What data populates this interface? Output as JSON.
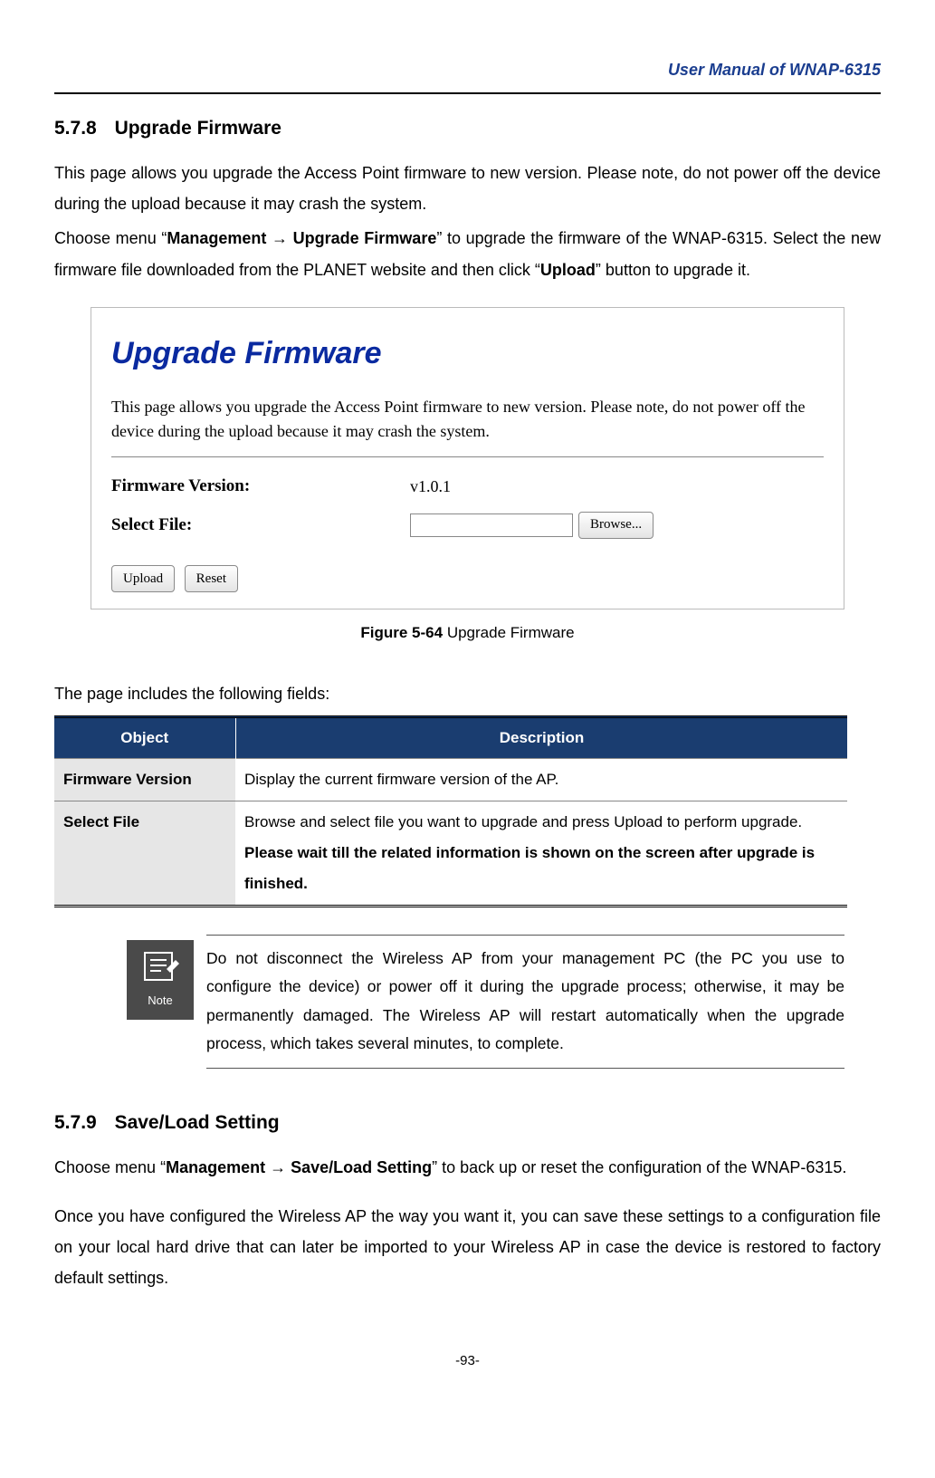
{
  "header": {
    "doc_title": "User Manual of WNAP-6315"
  },
  "section578": {
    "num": "5.7.8",
    "title": "Upgrade Firmware",
    "intro": "This page allows you upgrade the Access Point firmware to new version. Please note, do not power off the device during the upload because it may crash the system.",
    "menu_pre": "Choose menu “",
    "menu_bold": "Management → Upgrade Firmware",
    "menu_mid": "” to upgrade the firmware of the WNAP-6315. Select the new firmware file downloaded from the PLANET website and then click “",
    "menu_bold2": "Upload",
    "menu_post": "” button to upgrade it."
  },
  "shot": {
    "title": "Upgrade Firmware",
    "desc": "This page allows you upgrade the Access Point firmware to new version. Please note, do not power off the device during the upload because it may crash the system.",
    "fw_label": "Firmware Version:",
    "fw_value": "v1.0.1",
    "file_label": "Select File:",
    "browse": "Browse...",
    "upload": "Upload",
    "reset": "Reset"
  },
  "figure": {
    "num": "Figure 5-64",
    "caption": " Upgrade Firmware"
  },
  "fields_intro": "The page includes the following fields:",
  "table": {
    "head_obj": "Object",
    "head_desc": "Description",
    "rows": [
      {
        "obj": "Firmware Version",
        "desc": "Display the current firmware version of the AP.",
        "desc_bold": ""
      },
      {
        "obj": "Select File",
        "desc": "Browse and select file you want to upgrade and press Upload to perform upgrade.",
        "desc_bold": "Please wait till the related information is shown on the screen after upgrade is finished."
      }
    ]
  },
  "note": {
    "label": "Note",
    "text": "Do not disconnect the Wireless AP from your management PC (the PC you use to configure the device) or power off it during the upgrade process; otherwise, it may be permanently damaged. The Wireless AP will restart automatically when the upgrade process, which takes several minutes, to complete."
  },
  "section579": {
    "num": "5.7.9",
    "title": "Save/Load Setting",
    "menu_pre": "Choose menu “",
    "menu_bold": "Management → Save/Load Setting",
    "menu_post": "” to back up or reset the configuration of the WNAP-6315.",
    "para2": "Once you have configured the Wireless AP the way you want it, you can save these settings to a configuration file on your local hard drive that can later be imported to your Wireless AP in case the device is restored to factory default settings."
  },
  "footer": {
    "pagenum": "-93-"
  }
}
